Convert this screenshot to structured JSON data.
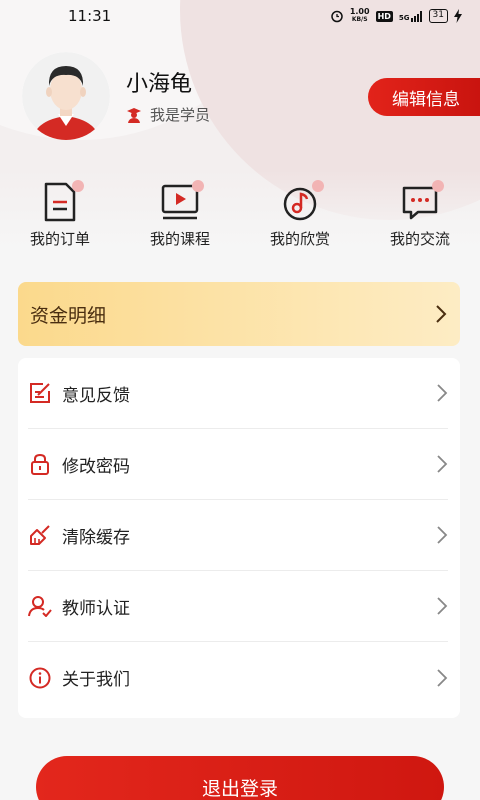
{
  "status_bar": {
    "time": "11:31",
    "rate_value": "1.00",
    "rate_unit": "KB/S",
    "hd": "HD",
    "network": "5G",
    "battery": "31"
  },
  "profile": {
    "name": "小海龟",
    "role": "我是学员",
    "edit_button": "编辑信息"
  },
  "quick_menu": [
    {
      "label": "我的订单",
      "icon": "order-document-icon"
    },
    {
      "label": "我的课程",
      "icon": "course-video-icon"
    },
    {
      "label": "我的欣赏",
      "icon": "music-note-icon"
    },
    {
      "label": "我的交流",
      "icon": "chat-bubble-icon"
    }
  ],
  "funds": {
    "label": "资金明细"
  },
  "settings": [
    {
      "label": "意见反馈",
      "icon": "feedback-edit-icon"
    },
    {
      "label": "修改密码",
      "icon": "lock-icon"
    },
    {
      "label": "清除缓存",
      "icon": "broom-icon"
    },
    {
      "label": "教师认证",
      "icon": "teacher-verify-icon"
    },
    {
      "label": "关于我们",
      "icon": "info-icon"
    }
  ],
  "logout": {
    "label": "退出登录"
  },
  "colors": {
    "accent": "#e2231a",
    "funds_bg": "#fbd98c"
  }
}
